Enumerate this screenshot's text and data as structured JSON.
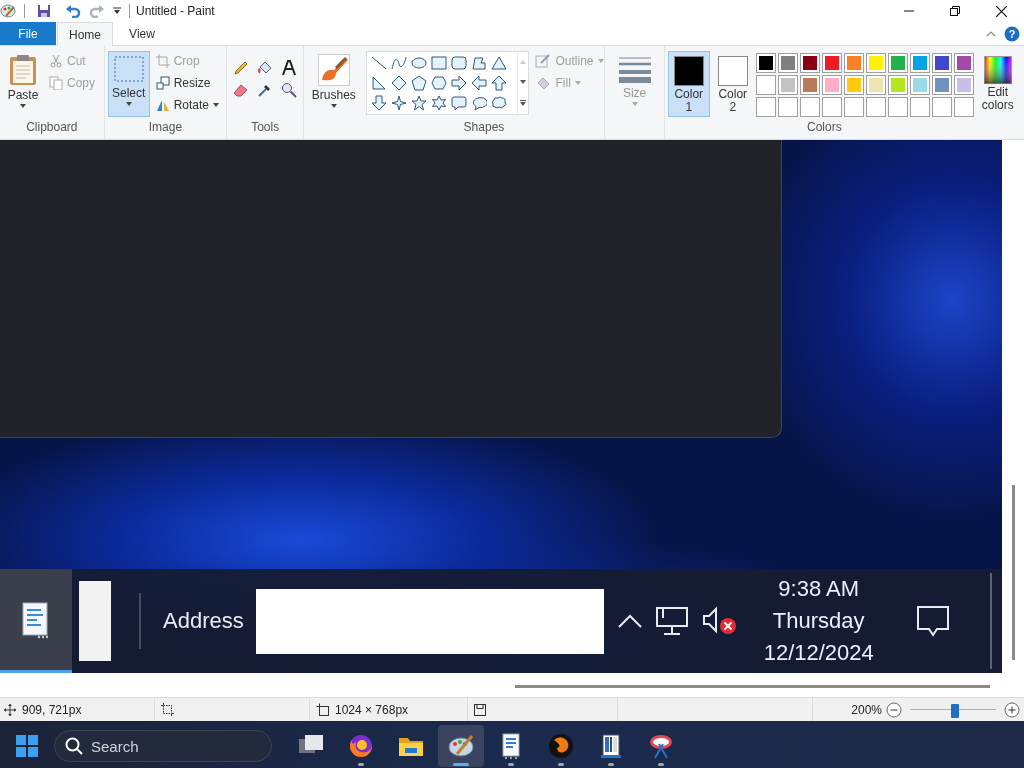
{
  "window": {
    "title": "Untitled - Paint"
  },
  "help": {
    "label": "?"
  },
  "tabs": [
    {
      "label": "File",
      "selected": false,
      "kind": "file"
    },
    {
      "label": "Home",
      "selected": true,
      "kind": "tab"
    },
    {
      "label": "View",
      "selected": false,
      "kind": "tab"
    }
  ],
  "ribbon": {
    "clipboard": {
      "label": "Clipboard",
      "paste": "Paste",
      "cut": {
        "label": "Cut",
        "disabled": true
      },
      "copy": {
        "label": "Copy",
        "disabled": true
      }
    },
    "image": {
      "label": "Image",
      "select": {
        "label": "Select",
        "selected": true
      },
      "crop": {
        "label": "Crop",
        "disabled": true
      },
      "resize": {
        "label": "Resize",
        "disabled": false
      },
      "rotate": {
        "label": "Rotate",
        "disabled": false
      }
    },
    "tools": {
      "label": "Tools"
    },
    "brushes": {
      "label": "Brushes"
    },
    "shapes": {
      "label": "Shapes",
      "outline": {
        "label": "Outline",
        "disabled": true
      },
      "fill": {
        "label": "Fill",
        "disabled": true
      }
    },
    "size": {
      "label": "Size",
      "disabled": true
    },
    "color_1": {
      "label": "Color",
      "number": "1",
      "selected": true,
      "color": "#000000"
    },
    "color_2": {
      "label": "Color",
      "number": "2",
      "selected": false,
      "color": "#ffffff"
    },
    "colors": {
      "label": "Colors",
      "palette": [
        {
          "color": "#000000"
        },
        {
          "color": "#7f7f7f"
        },
        {
          "color": "#880015"
        },
        {
          "color": "#ed1c24"
        },
        {
          "color": "#ff7f27"
        },
        {
          "color": "#fff200"
        },
        {
          "color": "#22b14c"
        },
        {
          "color": "#00a2e8"
        },
        {
          "color": "#3f48cc"
        },
        {
          "color": "#a349a4"
        },
        {
          "color": "#ffffff"
        },
        {
          "color": "#c3c3c3"
        },
        {
          "color": "#b97a57"
        },
        {
          "color": "#ffaec9"
        },
        {
          "color": "#ffc90e"
        },
        {
          "color": "#efe4b0"
        },
        {
          "color": "#b5e61d"
        },
        {
          "color": "#99d9ea"
        },
        {
          "color": "#7092be"
        },
        {
          "color": "#c8bfe7"
        }
      ],
      "edit_colors": "Edit colors"
    }
  },
  "canvas": {
    "inner_taskbar": {
      "app_selected": true,
      "address_label": "Address",
      "time": "9:38 AM",
      "day": "Thursday",
      "date": "12/12/2024"
    }
  },
  "status_bar": {
    "cursor_position": "909, 721px",
    "image_size": "1024 × 768px",
    "zoom": "200%",
    "zoom_slider": {
      "level": 0.52
    }
  },
  "taskbar": {
    "search_placeholder": "Search",
    "apps": [
      {
        "kind": "task-view",
        "selected": false,
        "running": false
      },
      {
        "kind": "firefox",
        "selected": false,
        "running": true
      },
      {
        "kind": "folder",
        "selected": false,
        "running": false
      },
      {
        "kind": "paint",
        "selected": true,
        "running": true
      },
      {
        "kind": "notepad",
        "selected": false,
        "running": true
      },
      {
        "kind": "orange-ball",
        "selected": false,
        "running": true
      },
      {
        "kind": "books",
        "selected": false,
        "running": true
      },
      {
        "kind": "snipping",
        "selected": false,
        "running": true
      }
    ]
  }
}
